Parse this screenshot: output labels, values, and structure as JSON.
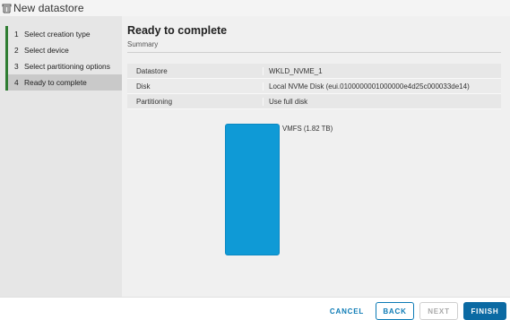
{
  "window": {
    "title": "New datastore",
    "icon": "datastore-icon"
  },
  "steps": [
    {
      "num": "1",
      "label": "Select creation type"
    },
    {
      "num": "2",
      "label": "Select device"
    },
    {
      "num": "3",
      "label": "Select partitioning options"
    },
    {
      "num": "4",
      "label": "Ready to complete"
    }
  ],
  "active_step": 4,
  "main": {
    "title": "Ready to complete",
    "subtitle": "Summary"
  },
  "summary": [
    {
      "key": "Datastore",
      "value": "WKLD_NVME_1"
    },
    {
      "key": "Disk",
      "value": "Local NVMe Disk (eui.0100000001000000e4d25c000033de14)"
    },
    {
      "key": "Partitioning",
      "value": "Use full disk"
    }
  ],
  "partition": {
    "label": "VMFS  (1.82 TB)",
    "color": "#0f9ad6"
  },
  "buttons": {
    "cancel": "CANCEL",
    "back": "BACK",
    "next": "NEXT",
    "finish": "FINISH"
  },
  "colors": {
    "accent": "#0b6aa3",
    "step_indicator": "#2f7d32"
  }
}
